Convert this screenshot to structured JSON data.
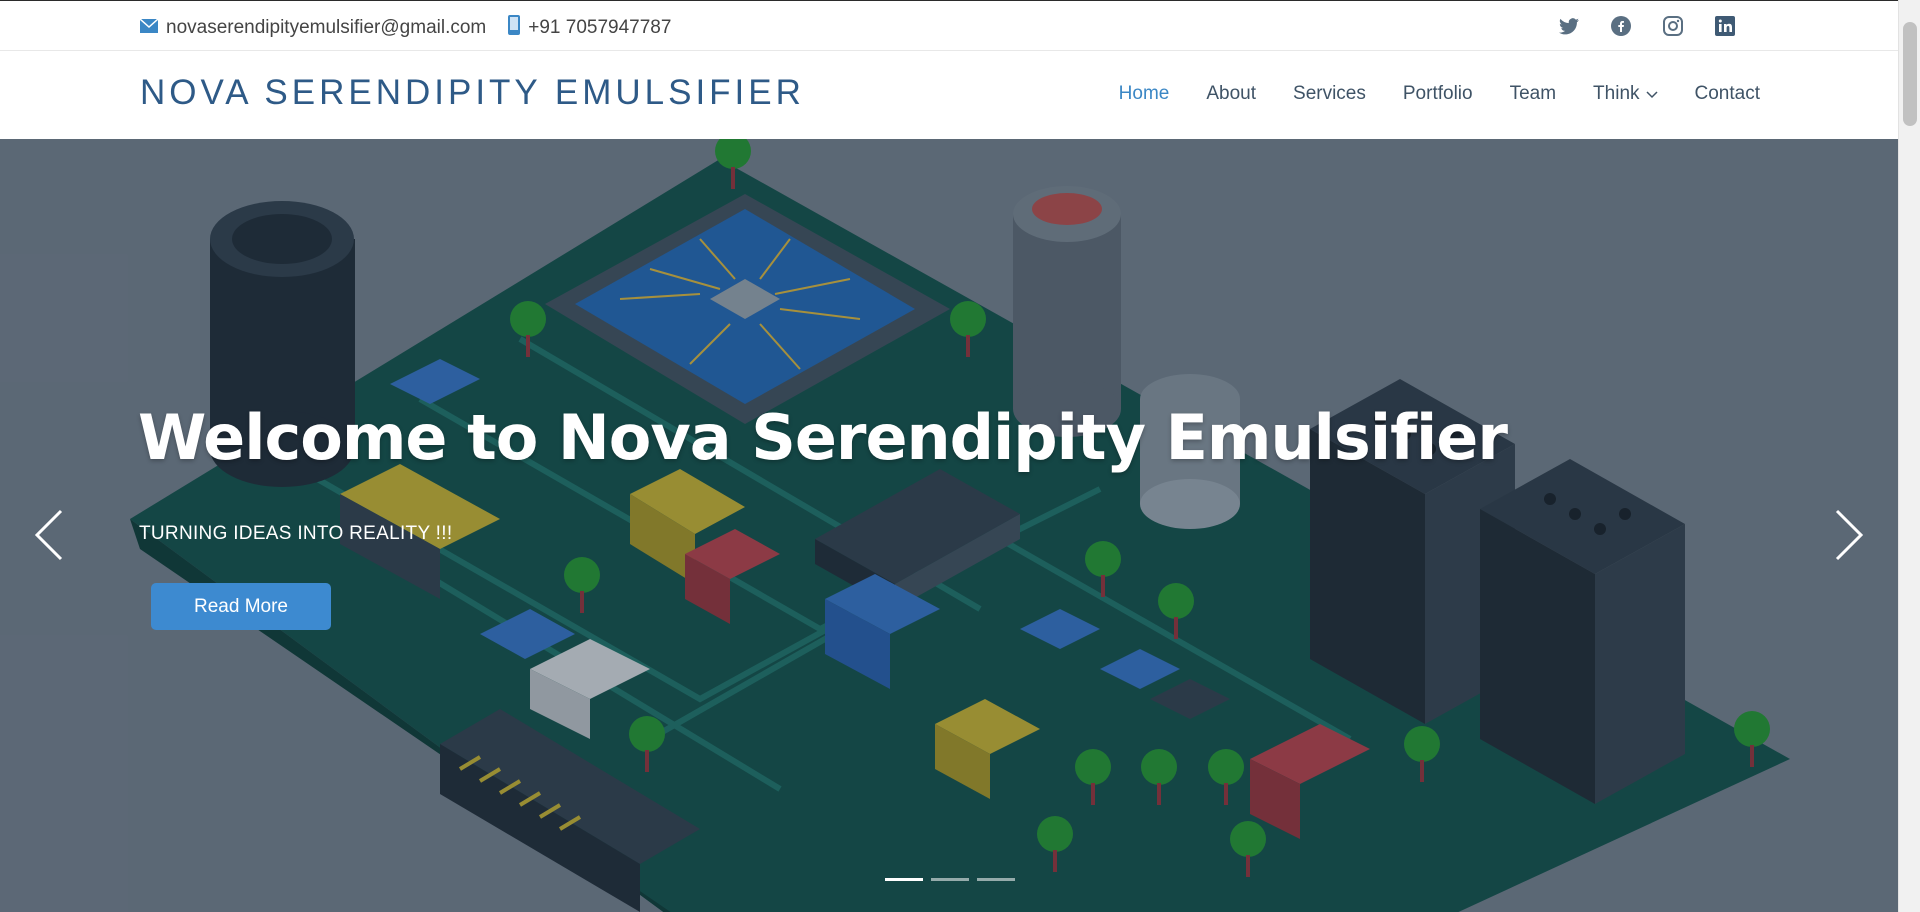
{
  "topbar": {
    "email": "novaserendipityemulsifier@gmail.com",
    "phone": "+91 7057947787",
    "social_icons": [
      "twitter-icon",
      "facebook-icon",
      "instagram-icon",
      "linkedin-icon"
    ]
  },
  "navbar": {
    "brand": "NOVA SERENDIPITY EMULSIFIER",
    "items": [
      {
        "label": "Home",
        "active": true
      },
      {
        "label": "About"
      },
      {
        "label": "Services"
      },
      {
        "label": "Portfolio"
      },
      {
        "label": "Team"
      },
      {
        "label": "Think",
        "dropdown": true
      },
      {
        "label": "Contact"
      }
    ]
  },
  "hero": {
    "title": "Welcome to Nova Serendipity Emulsifier",
    "subtitle": "TURNING IDEAS INTO REALITY !!!",
    "cta_label": "Read More",
    "slide_count": 3,
    "active_slide": 1
  },
  "colors": {
    "brand": "#2e5a87",
    "nav_active": "#3b87c5",
    "button": "#3d8ad0",
    "board": "#0f4a45"
  }
}
